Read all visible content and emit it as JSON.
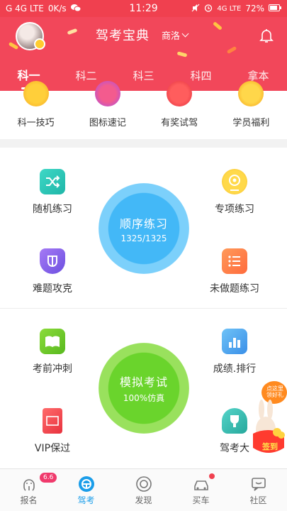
{
  "status_bar": {
    "network": "G 4G LTE",
    "speed": "0K/s",
    "time": "11:29",
    "right_network": "4G LTE",
    "battery": "72%"
  },
  "header": {
    "title": "驾考宝典",
    "city": "商洛"
  },
  "tabs": [
    "科一",
    "科二",
    "科三",
    "科四",
    "拿本"
  ],
  "quick_items": [
    "科一技巧",
    "图标速记",
    "有奖试驾",
    "学员福利"
  ],
  "features": {
    "random": "随机练习",
    "special": "专项练习",
    "hard": "难题攻克",
    "undone": "未做题练习",
    "sprint": "考前冲刺",
    "ranking": "成绩.排行",
    "vip": "VIP保过",
    "master": "驾考大"
  },
  "order_practice": {
    "title": "顺序练习",
    "progress": "1325/1325"
  },
  "mock_exam": {
    "title": "模拟考试",
    "sub": "100%仿真"
  },
  "signin": {
    "label": "签到",
    "tip": "点这里领好礼"
  },
  "bottom_nav": [
    {
      "label": "报名",
      "icon": "octopus-icon"
    },
    {
      "label": "驾考",
      "icon": "steering-wheel-icon"
    },
    {
      "label": "发现",
      "icon": "compass-icon"
    },
    {
      "label": "买车",
      "icon": "car-icon"
    },
    {
      "label": "社区",
      "icon": "chat-icon"
    }
  ],
  "nav_badge": "6.6",
  "colors": {
    "header": "#f2475a",
    "blue": "#43b8f7",
    "green": "#6ad42c",
    "active_nav": "#1a9de9"
  }
}
